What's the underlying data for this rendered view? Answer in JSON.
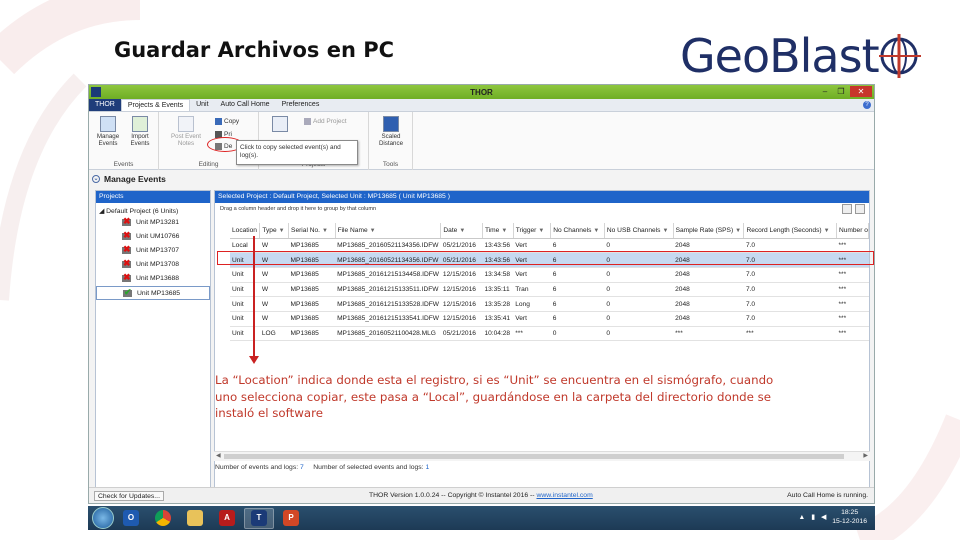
{
  "slide": {
    "title": "Guardar Archivos en PC",
    "logo_text": "GeoBlast"
  },
  "window": {
    "title": "THOR",
    "buttons": [
      "–",
      "❐",
      "✕"
    ]
  },
  "menu": {
    "items": [
      "THOR",
      "Projects & Events",
      "Unit",
      "Auto Call Home",
      "Preferences"
    ],
    "active_index": 1
  },
  "ribbon": {
    "events_group": {
      "label": "Events",
      "manage": "Manage Events",
      "import": "Import Events"
    },
    "editing_group": {
      "label": "Editing",
      "post_notes": "Post Event Notes",
      "copy": "Copy",
      "print": "Pri",
      "delete": "De",
      "add_project": "Add Project",
      "tooltip": "Click to copy selected event(s) and log(s)."
    },
    "projects_group": {
      "label": "Projects"
    },
    "tools_group": {
      "label": "Tools",
      "scaled": "Scaled Distance"
    }
  },
  "manage_events": {
    "title": "Manage Events",
    "collapse_glyph": "⌄"
  },
  "projects_panel": {
    "header": "Projects",
    "root": "Default Project (6 Units)",
    "units": [
      {
        "name": "Unit MP13281",
        "status": "error"
      },
      {
        "name": "Unit UM10766",
        "status": "error"
      },
      {
        "name": "Unit MP13707",
        "status": "error"
      },
      {
        "name": "Unit MP13708",
        "status": "error"
      },
      {
        "name": "Unit MP13688",
        "status": "error"
      },
      {
        "name": "Unit MP13685",
        "status": "ok"
      }
    ],
    "selected_index": 5
  },
  "grid": {
    "title": "Selected Project : Default Project,  Selected Unit : MP13685 ( Unit MP13685 )",
    "group_hint": "Drag a column header and drop it here to group by that column",
    "columns": [
      "Location",
      "Type",
      "Serial No.",
      "File Name",
      "Date",
      "Time",
      "Trigger",
      "No Channels",
      "No USB Channels",
      "Sample Rate (SPS)",
      "Record Length (Seconds)",
      "Number o"
    ],
    "rows": [
      [
        "Local",
        "W",
        "MP13685",
        "MP13685_20160521134356.IDFW",
        "05/21/2016",
        "13:43:56",
        "Vert",
        "6",
        "0",
        "2048",
        "7.0",
        "***"
      ],
      [
        "Unit",
        "W",
        "MP13685",
        "MP13685_20160521134356.IDFW",
        "05/21/2016",
        "13:43:56",
        "Vert",
        "6",
        "0",
        "2048",
        "7.0",
        "***"
      ],
      [
        "Unit",
        "W",
        "MP13685",
        "MP13685_20161215134458.IDFW",
        "12/15/2016",
        "13:34:58",
        "Vert",
        "6",
        "0",
        "2048",
        "7.0",
        "***"
      ],
      [
        "Unit",
        "W",
        "MP13685",
        "MP13685_20161215133511.IDFW",
        "12/15/2016",
        "13:35:11",
        "Tran",
        "6",
        "0",
        "2048",
        "7.0",
        "***"
      ],
      [
        "Unit",
        "W",
        "MP13685",
        "MP13685_20161215133528.IDFW",
        "12/15/2016",
        "13:35:28",
        "Long",
        "6",
        "0",
        "2048",
        "7.0",
        "***"
      ],
      [
        "Unit",
        "W",
        "MP13685",
        "MP13685_20161215133541.IDFW",
        "12/15/2016",
        "13:35:41",
        "Vert",
        "6",
        "0",
        "2048",
        "7.0",
        "***"
      ],
      [
        "Unit",
        "LOG",
        "MP13685",
        "MP13685_20160521100428.MLG",
        "05/21/2016",
        "10:04:28",
        "***",
        "0",
        "0",
        "***",
        "***",
        "***"
      ]
    ],
    "selected_row": 1,
    "events_label": "Number of events and logs:",
    "events_count": "7",
    "selected_label": "Number of selected events and logs:",
    "selected_count": "1"
  },
  "annotation": {
    "text": "La “Location” indica donde esta el registro, si es “Unit” se encuentra en el sismógrafo, cuando uno selecciona copiar, este pasa a “Local”, guardándose en la carpeta del directorio donde se instaló el software"
  },
  "statusbar": {
    "check_updates": "Check for Updates...",
    "version_text": "THOR Version 1.0.0.24 -- Copyright © Instantel 2016 --",
    "link": "www.instantel.com",
    "right": "Auto Call Home is running."
  },
  "taskbar": {
    "apps": [
      "outlook",
      "chrome",
      "explorer",
      "autocad",
      "thor",
      "powerpoint"
    ],
    "active_app": "thor",
    "time": "18:25",
    "date": "15-12-2016"
  },
  "colors": {
    "accent_red": "#c92121",
    "title_green": "#8dc63f",
    "header_blue": "#1f64c9",
    "logo_blue": "#1f2f66"
  }
}
